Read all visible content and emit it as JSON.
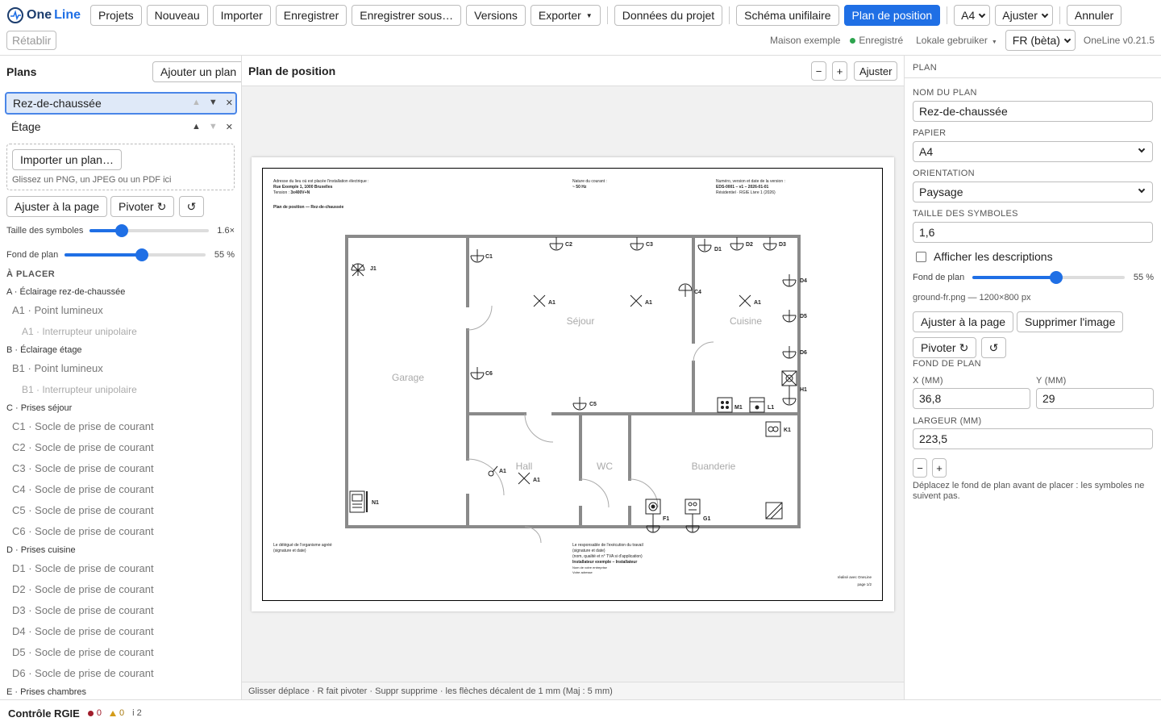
{
  "app": {
    "name_a": "One",
    "name_b": "Line",
    "version": "OneLine v0.21.5"
  },
  "toolbar": {
    "projets": "Projets",
    "nouveau": "Nouveau",
    "importer": "Importer",
    "enregistrer": "Enregistrer",
    "enregistrer_sous": "Enregistrer sous…",
    "versions": "Versions",
    "exporter": "Exporter",
    "donnees": "Données du projet",
    "schema": "Schéma unifilaire",
    "plan": "Plan de position",
    "paper": "A4",
    "ajuster": "Ajuster",
    "annuler": "Annuler",
    "retablir": "Rétablir"
  },
  "status": {
    "project": "Maison exemple",
    "saved": "Enregistré",
    "user": "Lokale gebruiker",
    "lang": "FR (bèta)"
  },
  "left": {
    "title": "Plans",
    "add_plan": "Ajouter un plan",
    "plans": [
      "Rez-de-chaussée",
      "Étage"
    ],
    "import_plan": "Importer un plan…",
    "drop_hint": "Glissez un PNG, un JPEG ou un PDF ici",
    "fit_page": "Ajuster à la page",
    "rotate": "Pivoter",
    "symbol_size_label": "Taille des symboles",
    "symbol_size_value": "1.6×",
    "symbol_size_fraction": 0.27,
    "bg_label": "Fond de plan",
    "bg_value": "55 %",
    "bg_fraction": 0.55,
    "to_place": "À PLACER",
    "groups": [
      {
        "label": "A · Éclairage rez-de-chaussée",
        "items": [
          {
            "label": "A1 · Point lumineux",
            "sub": "A1 · Interrupteur unipolaire"
          }
        ]
      },
      {
        "label": "B · Éclairage étage",
        "items": [
          {
            "label": "B1 · Point lumineux",
            "sub": "B1 · Interrupteur unipolaire"
          }
        ]
      },
      {
        "label": "C · Prises séjour",
        "items": [
          {
            "label": "C1 · Socle de prise de courant"
          },
          {
            "label": "C2 · Socle de prise de courant"
          },
          {
            "label": "C3 · Socle de prise de courant"
          },
          {
            "label": "C4 · Socle de prise de courant"
          },
          {
            "label": "C5 · Socle de prise de courant"
          },
          {
            "label": "C6 · Socle de prise de courant"
          }
        ]
      },
      {
        "label": "D · Prises cuisine",
        "items": [
          {
            "label": "D1 · Socle de prise de courant"
          },
          {
            "label": "D2 · Socle de prise de courant"
          },
          {
            "label": "D3 · Socle de prise de courant"
          },
          {
            "label": "D4 · Socle de prise de courant"
          },
          {
            "label": "D5 · Socle de prise de courant"
          },
          {
            "label": "D6 · Socle de prise de courant"
          }
        ]
      },
      {
        "label": "E · Prises chambres",
        "items": []
      }
    ]
  },
  "center": {
    "title": "Plan de position",
    "minus": "−",
    "plus": "+",
    "fit": "Ajuster",
    "hint": "Glisser déplace · R fait pivoter · Suppr supprime · les flèches décalent de 1 mm (Maj : 5 mm)",
    "sheet": {
      "addr_label": "Adresse du lieu où est placée l'installation électrique :",
      "addr": "Rue Exemple 1, 1000 Bruxelles",
      "tension_label": "Tension :",
      "tension": "3x400V+N",
      "plan_title": "Plan de position — Rez-de-chaussée",
      "current_label": "Nature du courant :",
      "current": "~ 50 Hz",
      "version_label": "Numéro, version et date de la version :",
      "version": "EDS-0001 – v1 – 2026-01-01",
      "kind": "Résidentiel · RGIE Livre 1 (2026)",
      "sig1a": "Le délégué de l'organisme agréé",
      "sig1b": "(signature et date)",
      "sig2a": "Le responsable de l'exécution du travail",
      "sig2b": "(signature et date)",
      "sig2c": "(nom, qualité et n° TVA si d'application)",
      "sig2d": "Installateur exemple – Installateur",
      "sig2e": "Nom de votre entreprise",
      "sig2f": "Votre adresse",
      "made_with": "réalisé avec OneLine",
      "page": "page 1/2",
      "rooms": {
        "sejour": "Séjour",
        "cuisine": "Cuisine",
        "garage": "Garage",
        "hall": "Hall",
        "wc": "WC",
        "buanderie": "Buanderie"
      },
      "labels": {
        "J1": "J1",
        "C1": "C1",
        "C2": "C2",
        "C3": "C3",
        "C4": "C4",
        "C5": "C5",
        "C6": "C6",
        "D1": "D1",
        "D2": "D2",
        "D3": "D3",
        "D4": "D4",
        "D5": "D5",
        "D6": "D6",
        "A1": "A1",
        "H1": "H1",
        "M1": "M1",
        "L1": "L1",
        "K1": "K1",
        "F1": "F1",
        "G1": "G1",
        "N1": "N1"
      }
    }
  },
  "right": {
    "section": "PLAN",
    "name_label": "NOM DU PLAN",
    "name_value": "Rez-de-chaussée",
    "paper_label": "PAPIER",
    "paper_value": "A4",
    "orient_label": "ORIENTATION",
    "orient_value": "Paysage",
    "size_label": "TAILLE DES SYMBOLES",
    "size_value": "1,6",
    "show_desc": "Afficher les descriptions",
    "bg_label": "Fond de plan",
    "bg_value": "55 %",
    "bg_fraction": 0.55,
    "file_info": "ground-fr.png — 1200×800 px",
    "fit_page": "Ajuster à la page",
    "remove_image": "Supprimer l'image",
    "rotate": "Pivoter",
    "bg_section": "FOND DE PLAN",
    "x_label": "X (MM)",
    "x_value": "36,8",
    "y_label": "Y (MM)",
    "y_value": "29",
    "w_label": "LARGEUR (MM)",
    "w_value": "223,5",
    "minus": "−",
    "plus": "+",
    "note": "Déplacez le fond de plan avant de placer : les symboles ne suivent pas."
  },
  "bottom": {
    "title": "Contrôle RGIE",
    "errors": "0",
    "warnings": "0",
    "info": "i 2"
  }
}
